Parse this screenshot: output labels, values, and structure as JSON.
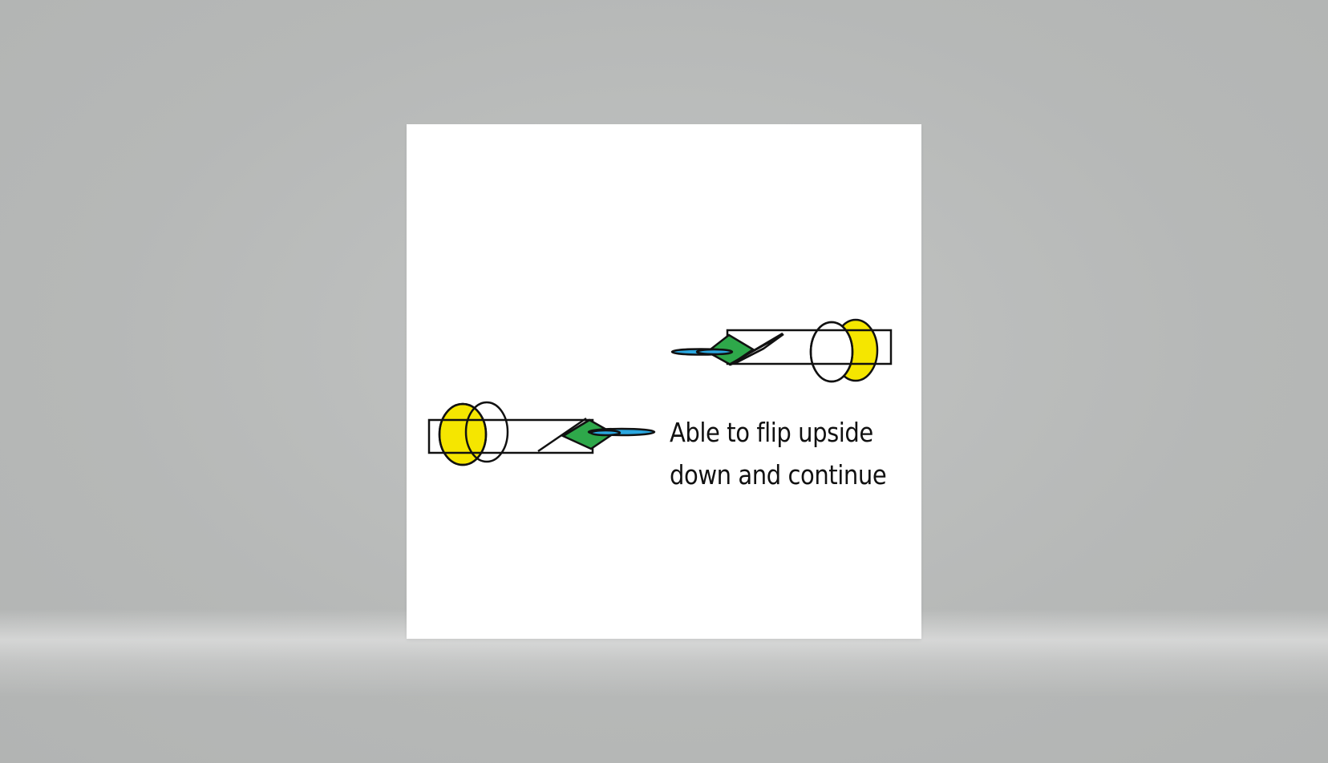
{
  "caption": {
    "line1": "Able to flip upside",
    "line2": "down and continue"
  },
  "colors": {
    "background": "#b6b8b7",
    "slide": "#ffffff",
    "ring_fill": "#f5e600",
    "diamond_fill": "#2ea84a",
    "blade_fill": "#2aa7e0",
    "stroke": "#111111"
  },
  "icons": {
    "device_upright": "magnifier-scraper-icon",
    "device_flipped": "magnifier-scraper-flipped-icon"
  }
}
